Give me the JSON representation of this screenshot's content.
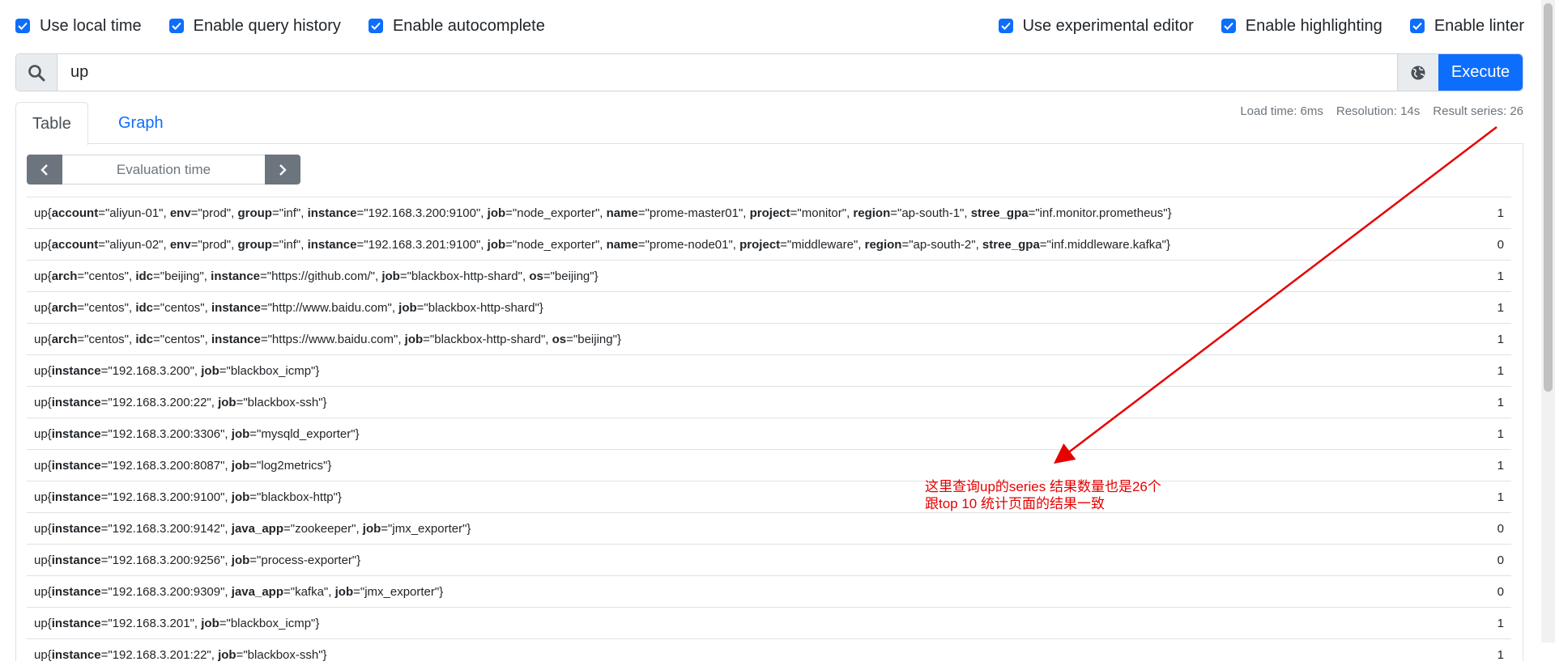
{
  "options": {
    "left": [
      {
        "label": "Use local time",
        "checked": true
      },
      {
        "label": "Enable query history",
        "checked": true
      },
      {
        "label": "Enable autocomplete",
        "checked": true
      }
    ],
    "right": [
      {
        "label": "Use experimental editor",
        "checked": true
      },
      {
        "label": "Enable highlighting",
        "checked": true
      },
      {
        "label": "Enable linter",
        "checked": true
      }
    ]
  },
  "query": {
    "expression": "up",
    "execute_label": "Execute",
    "search_icon": "search-icon",
    "metrics_icon": "globe-icon"
  },
  "tabs": {
    "table": "Table",
    "graph": "Graph"
  },
  "stats": {
    "load_time": "Load time: 6ms",
    "resolution": "Resolution: 14s",
    "result_series": "Result series: 26"
  },
  "eval": {
    "placeholder": "Evaluation time"
  },
  "results": [
    {
      "labels": [
        [
          "account",
          "aliyun-01"
        ],
        [
          "env",
          "prod"
        ],
        [
          "group",
          "inf"
        ],
        [
          "instance",
          "192.168.3.200:9100"
        ],
        [
          "job",
          "node_exporter"
        ],
        [
          "name",
          "prome-master01"
        ],
        [
          "project",
          "monitor"
        ],
        [
          "region",
          "ap-south-1"
        ],
        [
          "stree_gpa",
          "inf.monitor.prometheus"
        ]
      ],
      "value": "1"
    },
    {
      "labels": [
        [
          "account",
          "aliyun-02"
        ],
        [
          "env",
          "prod"
        ],
        [
          "group",
          "inf"
        ],
        [
          "instance",
          "192.168.3.201:9100"
        ],
        [
          "job",
          "node_exporter"
        ],
        [
          "name",
          "prome-node01"
        ],
        [
          "project",
          "middleware"
        ],
        [
          "region",
          "ap-south-2"
        ],
        [
          "stree_gpa",
          "inf.middleware.kafka"
        ]
      ],
      "value": "0"
    },
    {
      "labels": [
        [
          "arch",
          "centos"
        ],
        [
          "idc",
          "beijing"
        ],
        [
          "instance",
          "https://github.com/"
        ],
        [
          "job",
          "blackbox-http-shard"
        ],
        [
          "os",
          "beijing"
        ]
      ],
      "value": "1"
    },
    {
      "labels": [
        [
          "arch",
          "centos"
        ],
        [
          "idc",
          "centos"
        ],
        [
          "instance",
          "http://www.baidu.com"
        ],
        [
          "job",
          "blackbox-http-shard"
        ]
      ],
      "value": "1"
    },
    {
      "labels": [
        [
          "arch",
          "centos"
        ],
        [
          "idc",
          "centos"
        ],
        [
          "instance",
          "https://www.baidu.com"
        ],
        [
          "job",
          "blackbox-http-shard"
        ],
        [
          "os",
          "beijing"
        ]
      ],
      "value": "1"
    },
    {
      "labels": [
        [
          "instance",
          "192.168.3.200"
        ],
        [
          "job",
          "blackbox_icmp"
        ]
      ],
      "value": "1"
    },
    {
      "labels": [
        [
          "instance",
          "192.168.3.200:22"
        ],
        [
          "job",
          "blackbox-ssh"
        ]
      ],
      "value": "1"
    },
    {
      "labels": [
        [
          "instance",
          "192.168.3.200:3306"
        ],
        [
          "job",
          "mysqld_exporter"
        ]
      ],
      "value": "1"
    },
    {
      "labels": [
        [
          "instance",
          "192.168.3.200:8087"
        ],
        [
          "job",
          "log2metrics"
        ]
      ],
      "value": "1"
    },
    {
      "labels": [
        [
          "instance",
          "192.168.3.200:9100"
        ],
        [
          "job",
          "blackbox-http"
        ]
      ],
      "value": "1"
    },
    {
      "labels": [
        [
          "instance",
          "192.168.3.200:9142"
        ],
        [
          "java_app",
          "zookeeper"
        ],
        [
          "job",
          "jmx_exporter"
        ]
      ],
      "value": "0"
    },
    {
      "labels": [
        [
          "instance",
          "192.168.3.200:9256"
        ],
        [
          "job",
          "process-exporter"
        ]
      ],
      "value": "0"
    },
    {
      "labels": [
        [
          "instance",
          "192.168.3.200:9309"
        ],
        [
          "java_app",
          "kafka"
        ],
        [
          "job",
          "jmx_exporter"
        ]
      ],
      "value": "0"
    },
    {
      "labels": [
        [
          "instance",
          "192.168.3.201"
        ],
        [
          "job",
          "blackbox_icmp"
        ]
      ],
      "value": "1"
    },
    {
      "labels": [
        [
          "instance",
          "192.168.3.201:22"
        ],
        [
          "job",
          "blackbox-ssh"
        ]
      ],
      "value": "1"
    }
  ],
  "annotation": {
    "line1": "这里查询up的series 结果数量也是26个",
    "line2": "跟top 10 统计页面的结果一致",
    "color": "#e60000"
  },
  "colors": {
    "accent": "#0d6efd",
    "secondary": "#6c757d",
    "annotation": "#e60000"
  }
}
